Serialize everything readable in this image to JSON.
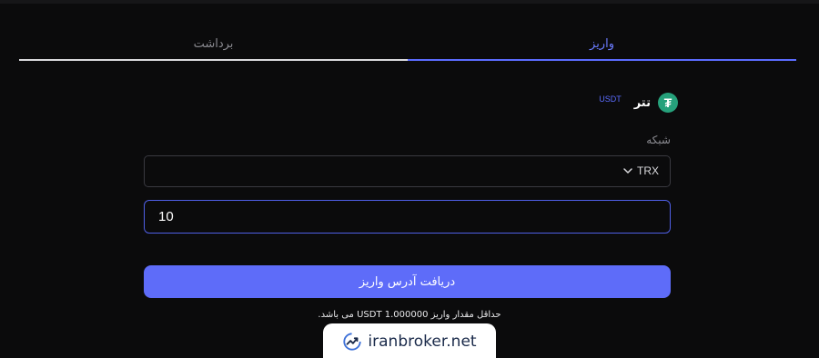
{
  "tabs": {
    "withdraw_label": "برداشت",
    "deposit_label": "واریز",
    "active": "deposit"
  },
  "coin": {
    "icon": "tether-icon",
    "icon_glyph": "₮",
    "name": "تتر",
    "symbol": "USDT",
    "icon_color": "#26a17b"
  },
  "network": {
    "label": "شبکه",
    "selected": "TRX",
    "icon": "chevron-down-icon"
  },
  "amount": {
    "value": "10"
  },
  "submit": {
    "label": "دریافت آدرس واریز"
  },
  "note": {
    "min_deposit": "حداقل مقدار واریز USDT 1.000000 می باشد."
  },
  "watermark": {
    "text": "iranbroker.net",
    "icon": "trend-chart-icon"
  },
  "colors": {
    "accent": "#5e6cf9",
    "background": "#0b0b0c"
  }
}
